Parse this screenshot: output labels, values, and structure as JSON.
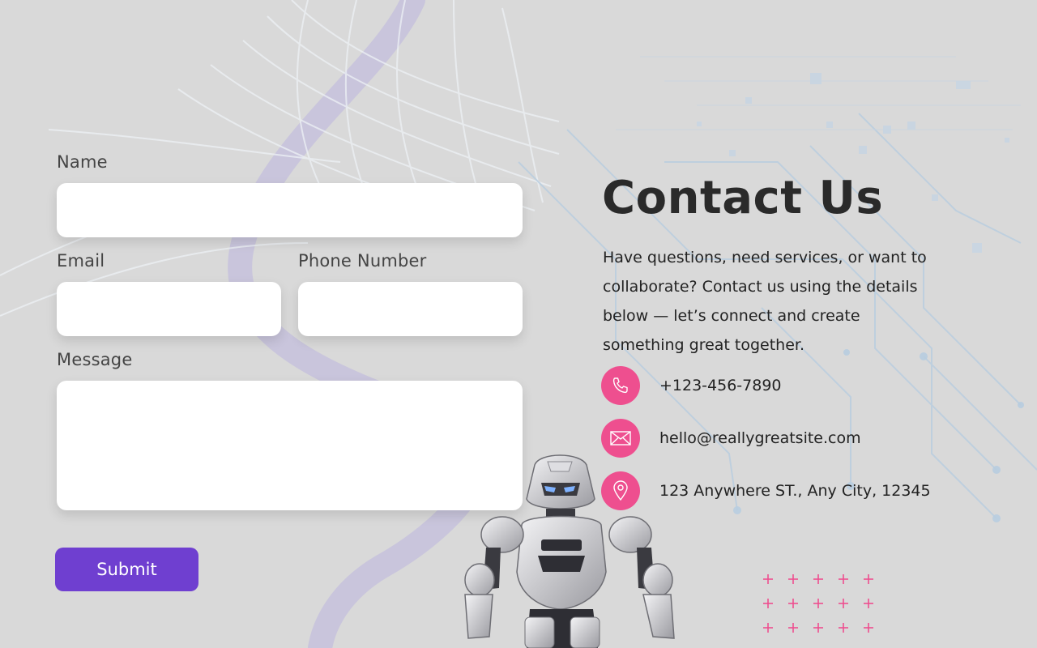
{
  "form": {
    "name_label": "Name",
    "name_value": "",
    "email_label": "Email",
    "email_value": "",
    "phone_label": "Phone Number",
    "phone_value": "",
    "message_label": "Message",
    "message_value": "",
    "submit_label": "Submit"
  },
  "contact": {
    "title": "Contact Us",
    "description": "Have questions, need services, or want to collaborate? Contact us using the details below — let’s connect and create something great together.",
    "items": [
      {
        "icon": "phone-icon",
        "text": "+123-456-7890"
      },
      {
        "icon": "mail-icon",
        "text": "hello@reallygreatsite.com"
      },
      {
        "icon": "location-pin-icon",
        "text": "123 Anywhere ST., Any City, 12345"
      }
    ]
  },
  "colors": {
    "background": "#d9d9d9",
    "accent_purple": "#6f3fd0",
    "accent_pink": "#ee4f8f"
  }
}
